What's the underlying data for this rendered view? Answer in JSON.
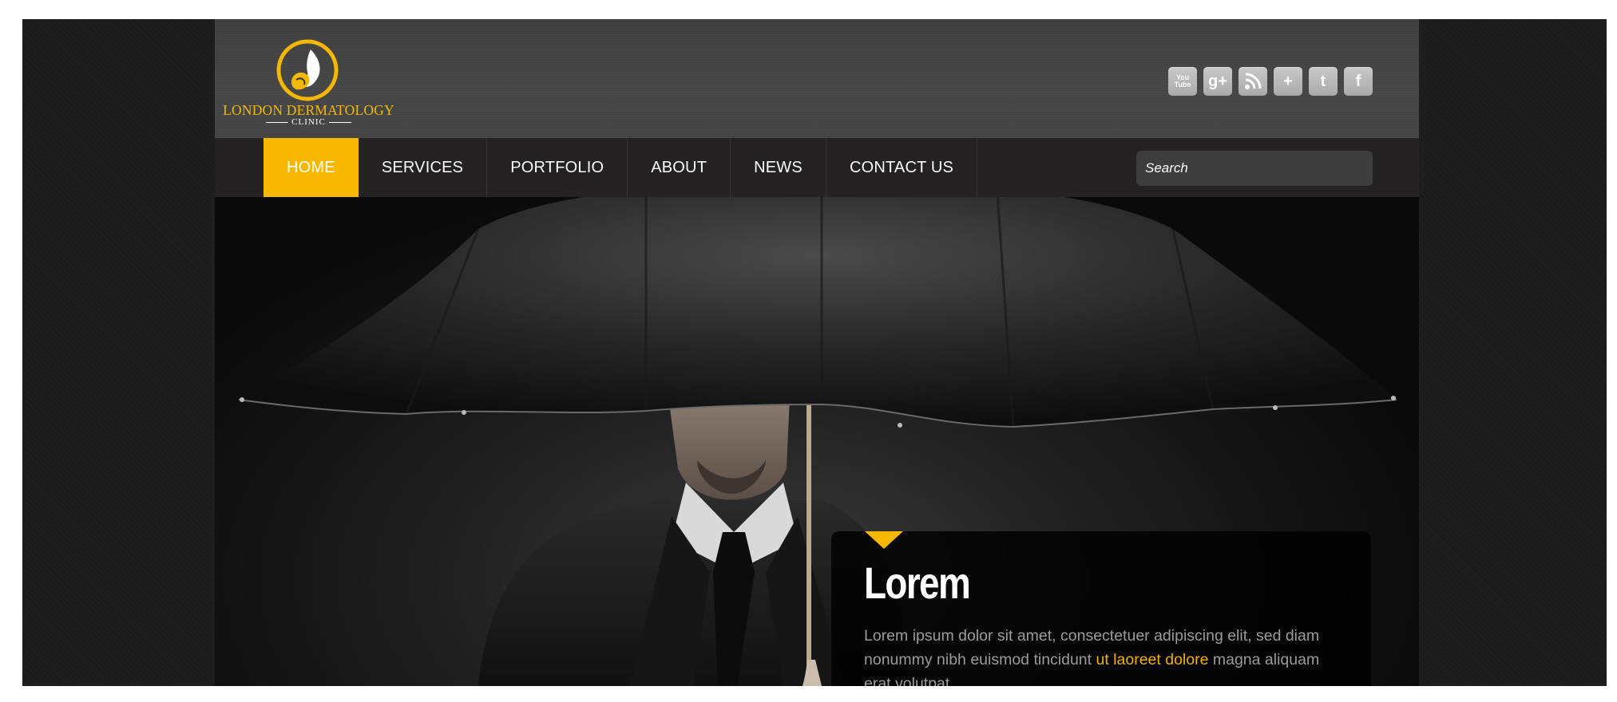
{
  "logo": {
    "title": "LONDON DERMATOLOGY",
    "subtitle": "CLINIC",
    "accent": "#f5b800"
  },
  "social": [
    {
      "icon": "youtube-icon",
      "label": "You Tube"
    },
    {
      "icon": "google-plus-icon",
      "label": "g+"
    },
    {
      "icon": "rss-icon",
      "label": ""
    },
    {
      "icon": "plus-icon",
      "label": "+"
    },
    {
      "icon": "twitter-icon",
      "label": "t"
    },
    {
      "icon": "facebook-icon",
      "label": "f"
    }
  ],
  "nav": {
    "items": [
      {
        "label": "HOME",
        "active": true
      },
      {
        "label": "SERVICES",
        "active": false
      },
      {
        "label": "PORTFOLIO",
        "active": false
      },
      {
        "label": "ABOUT",
        "active": false
      },
      {
        "label": "NEWS",
        "active": false
      },
      {
        "label": "CONTACT US",
        "active": false
      }
    ],
    "active_color": "#f9b800"
  },
  "search": {
    "placeholder": "Search",
    "value": ""
  },
  "hero": {
    "image": "man-with-black-umbrella",
    "caption": {
      "title": "Lorem",
      "text_before": "Lorem ipsum dolor sit amet, consectetuer adipiscing elit, sed diam nonummy nibh euismod tincidunt ",
      "highlight": "ut laoreet dolore",
      "text_after": " magna aliquam erat volutpat."
    }
  }
}
